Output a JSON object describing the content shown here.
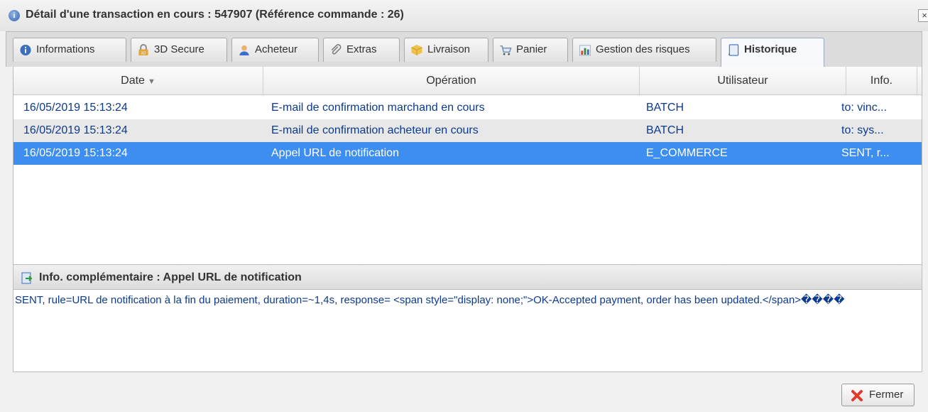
{
  "window": {
    "title": "Détail d'une transaction en cours : 547907 (Référence commande : 26)",
    "close_label": "×"
  },
  "tabs": [
    {
      "label": "Informations",
      "icon": "info-icon"
    },
    {
      "label": "3D Secure",
      "icon": "lock-3d-icon"
    },
    {
      "label": "Acheteur",
      "icon": "user-icon"
    },
    {
      "label": "Extras",
      "icon": "paperclip-icon"
    },
    {
      "label": "Livraison",
      "icon": "package-icon"
    },
    {
      "label": "Panier",
      "icon": "cart-icon"
    },
    {
      "label": "Gestion des risques",
      "icon": "chart-icon"
    },
    {
      "label": "Historique",
      "icon": "scroll-icon",
      "active": true
    }
  ],
  "grid": {
    "columns": [
      "Date",
      "Opération",
      "Utilisateur",
      "Info."
    ],
    "rows": [
      {
        "date": "16/05/2019 15:13:24",
        "operation": "E-mail de confirmation marchand en cours",
        "user": "BATCH",
        "info": "to: vinc..."
      },
      {
        "date": "16/05/2019 15:13:24",
        "operation": "E-mail de confirmation acheteur en cours",
        "user": "BATCH",
        "info": "to: sys..."
      },
      {
        "date": "16/05/2019 15:13:24",
        "operation": "Appel URL de notification",
        "user": "E_COMMERCE",
        "info": "SENT, r...",
        "selected": true
      }
    ]
  },
  "info_panel": {
    "title": "Info. complémentaire : Appel URL de notification",
    "body": "SENT, rule=URL de notification à la fin du paiement, duration=~1,4s, response= <span style=\"display: none;\">OK-Accepted payment, order has been updated.</span>����"
  },
  "footer": {
    "close_button": "Fermer"
  },
  "colors": {
    "selected_row": "#3d8ef0",
    "link_text": "#0c3a8f"
  }
}
